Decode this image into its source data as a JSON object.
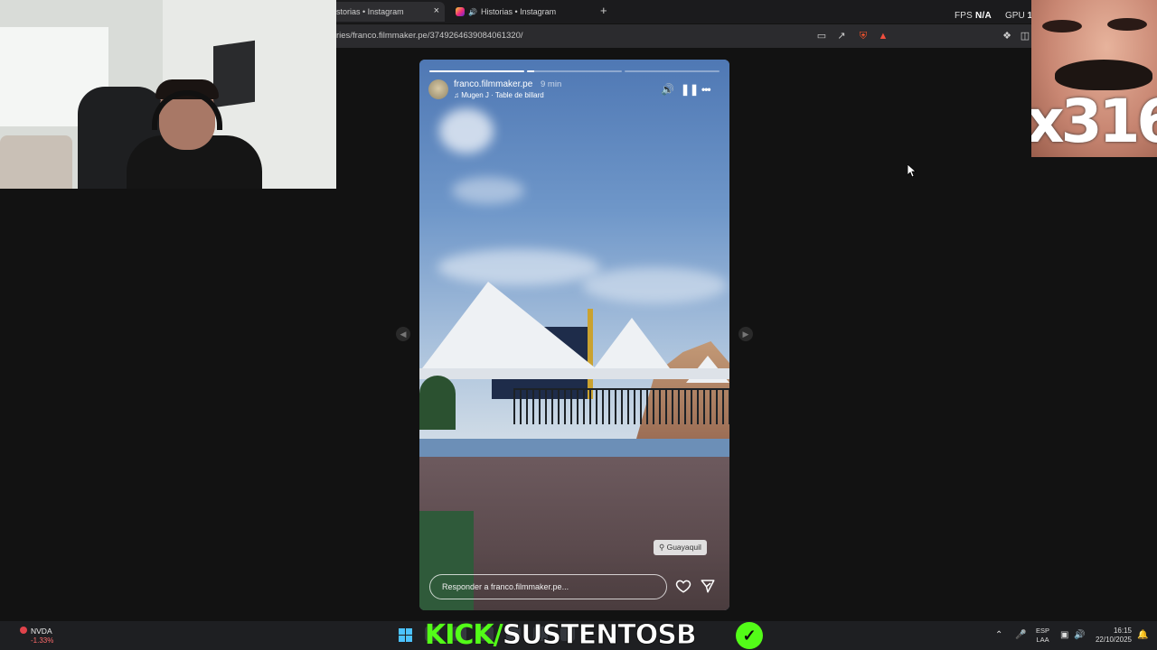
{
  "browser": {
    "tabs": [
      {
        "label": "storias • Instagram",
        "active": true
      },
      {
        "label": "Historias • Instagram",
        "active": false
      }
    ],
    "tab_close_glyph": "×",
    "new_tab_glyph": "+",
    "url": "ries/franco.filmmaker.pe/3749264639084061320/",
    "toolbar_icons": [
      "cast-icon",
      "share-icon",
      "brave-shield-icon",
      "brave-rewards-icon",
      "extensions-icon",
      "sidebar-icon"
    ]
  },
  "overlay": {
    "fps_label": "FPS",
    "fps_value": "N/A",
    "gpu_label": "GPU",
    "gpu_value": "1",
    "emote_text": "x316"
  },
  "story": {
    "username": "franco.filmmaker.pe",
    "time_ago": "9 min",
    "music": "Mugen J · Table de billard",
    "location": "Guayaquil",
    "reply_placeholder": "Responder a franco.filmmaker.pe...",
    "progress": [
      1.0,
      0.08,
      0.0
    ],
    "icons": {
      "mute": "volume-icon",
      "pause": "pause-icon",
      "more": "more-options-icon",
      "like": "heart-icon",
      "share": "send-icon",
      "location": "location-pin-icon"
    }
  },
  "taskbar": {
    "stock_name": "NVDA",
    "stock_change": "-1.33%",
    "kick_text_a": "KICK/",
    "kick_text_b": "SUSTENTOSB",
    "lang_line1": "ESP",
    "lang_line2": "LAA",
    "time": "16:15",
    "date": "22/10/2025"
  },
  "colors": {
    "kick_green": "#53fc18",
    "page_bg": "#121212",
    "windows_blue": "#4cc2ff"
  }
}
